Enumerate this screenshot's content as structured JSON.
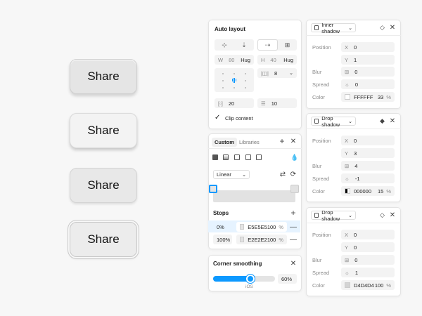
{
  "share_buttons": [
    "Share",
    "Share",
    "Share",
    "Share"
  ],
  "auto_layout": {
    "title": "Auto layout",
    "width_label": "W",
    "width_value": "80",
    "width_mode": "Hug",
    "height_label": "H",
    "height_value": "40",
    "height_mode": "Hug",
    "gap_value": "8",
    "padding_h": "20",
    "padding_v": "10",
    "clip_label": "Clip content"
  },
  "fill": {
    "tab_custom": "Custom",
    "tab_libraries": "Libraries",
    "type": "Linear",
    "stops_title": "Stops",
    "stops": [
      {
        "position": "0%",
        "hex": "E5E5E5",
        "opacity": "100",
        "pct": "%",
        "color": "#e5e5e5"
      },
      {
        "position": "100%",
        "hex": "E2E2E2",
        "opacity": "100",
        "pct": "%",
        "color": "#e2e2e2"
      }
    ]
  },
  "corner": {
    "title": "Corner smoothing",
    "value": "60%",
    "preset": "iOS",
    "fraction": 0.6
  },
  "shadows": [
    {
      "type": "Inner shadow",
      "labels": {
        "position": "Position",
        "blur": "Blur",
        "spread": "Spread",
        "color": "Color"
      },
      "x": "0",
      "y": "1",
      "blur": "0",
      "spread": "0",
      "hex": "FFFFFF",
      "opacity": "33",
      "pct": "%",
      "color": "#ffffff"
    },
    {
      "type": "Drop shadow",
      "labels": {
        "position": "Position",
        "blur": "Blur",
        "spread": "Spread",
        "color": "Color"
      },
      "x": "0",
      "y": "3",
      "blur": "4",
      "spread": "-1",
      "hex": "000000",
      "opacity": "15",
      "pct": "%",
      "color": "#000000"
    },
    {
      "type": "Drop shadow",
      "labels": {
        "position": "Position",
        "blur": "Blur",
        "spread": "Spread",
        "color": "Color"
      },
      "x": "0",
      "y": "0",
      "blur": "0",
      "spread": "1",
      "hex": "D4D4D4",
      "opacity": "100",
      "pct": "%",
      "color": "#d4d4d4"
    }
  ],
  "axis": {
    "x": "X",
    "y": "Y"
  },
  "colors": {
    "accent": "#0d99ff"
  }
}
